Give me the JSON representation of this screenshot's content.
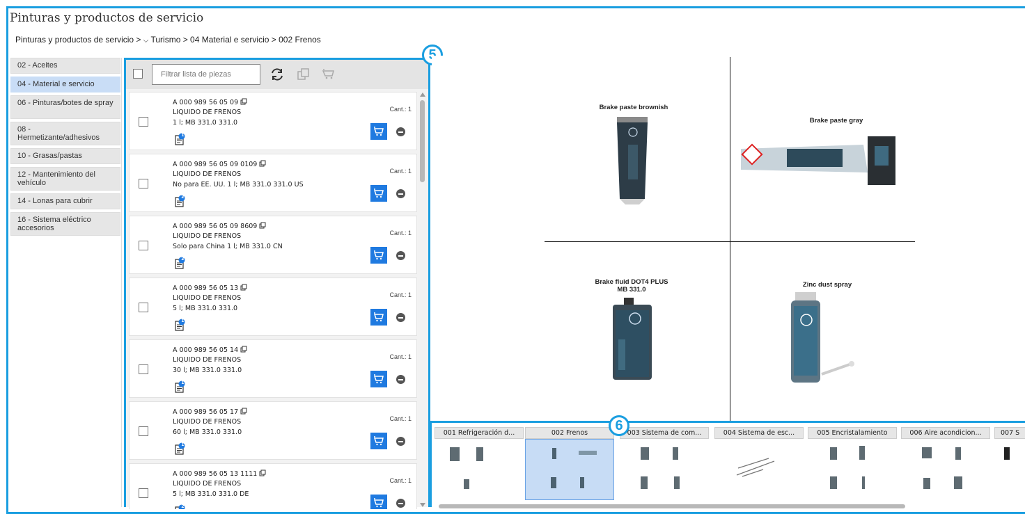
{
  "page_title": "Pinturas y productos de servicio",
  "breadcrumb": {
    "root": "Pinturas y productos de servicio >",
    "chevron": "⌵",
    "rest": "Turismo > 04 Material e servicio > 002 Frenos"
  },
  "sidebar": {
    "items": [
      {
        "label": "02 - Aceites"
      },
      {
        "label": "04 - Material e servicio",
        "active": true
      },
      {
        "label": "06 - Pinturas/botes de spray"
      },
      {
        "label": "08 - Hermetizante/adhesivos"
      },
      {
        "label": "10 - Grasas/pastas"
      },
      {
        "label": "12 - Mantenimiento del vehículo"
      },
      {
        "label": "14 - Lonas para cubrir"
      },
      {
        "label": "16 - Sistema eléctrico accesorios"
      }
    ]
  },
  "parts_panel": {
    "badge": "5",
    "filter_placeholder": "Filtrar lista de piezas",
    "qty_label": "Cant.: 1",
    "parts": [
      {
        "number": "A 000 989 56 05 09",
        "name": "LIQUIDO DE FRENOS",
        "desc": "1 l; MB 331.0 331.0",
        "notes": "1"
      },
      {
        "number": "A 000 989 56 05 09 0109",
        "name": "LIQUIDO DE FRENOS",
        "desc": "No para EE. UU. 1 l; MB 331.0 331.0 US",
        "notes": "2"
      },
      {
        "number": "A 000 989 56 05 09 8609",
        "name": "LIQUIDO DE FRENOS",
        "desc": "Solo para China 1 l; MB 331.0 CN",
        "notes": "2"
      },
      {
        "number": "A 000 989 56 05 13",
        "name": "LIQUIDO DE FRENOS",
        "desc": "5 l; MB 331.0 331.0",
        "notes": "1"
      },
      {
        "number": "A 000 989 56 05 14",
        "name": "LIQUIDO DE FRENOS",
        "desc": "30 l; MB 331.0 331.0",
        "notes": "1"
      },
      {
        "number": "A 000 989 56 05 17",
        "name": "LIQUIDO DE FRENOS",
        "desc": "60 l; MB 331.0 331.0",
        "notes": "1"
      },
      {
        "number": "A 000 989 56 05 13 1111",
        "name": "LIQUIDO DE FRENOS",
        "desc": "5 l; MB 331.0 331.0 DE",
        "notes": "2"
      }
    ]
  },
  "image_panel": {
    "products": [
      {
        "label": "Brake paste brownish"
      },
      {
        "label": "Brake paste gray"
      },
      {
        "label": "Brake fluid DOT4 PLUS\nMB 331.0"
      },
      {
        "label": "Zinc dust spray"
      }
    ]
  },
  "thumb_panel": {
    "badge": "6",
    "thumbs": [
      {
        "title": "001 Refrigeración d..."
      },
      {
        "title": "002 Frenos",
        "active": true
      },
      {
        "title": "003 Sistema de com..."
      },
      {
        "title": "004 Sistema de esc..."
      },
      {
        "title": "005 Encristalamiento"
      },
      {
        "title": "006 Aire acondicion..."
      },
      {
        "title": "007 S"
      }
    ]
  },
  "colors": {
    "accent": "#1a9ee0",
    "cart": "#1f7ae0",
    "active_bg": "#c9ddf6"
  }
}
